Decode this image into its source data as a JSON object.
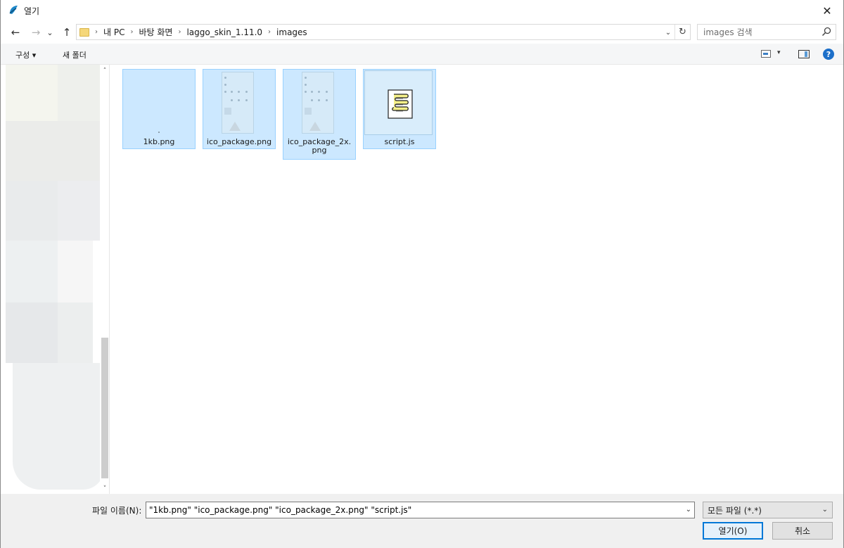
{
  "window": {
    "title": "열기",
    "close_glyph": "✕"
  },
  "nav": {
    "back_glyph": "←",
    "forward_glyph": "→",
    "recent_glyph": "⌄",
    "up_glyph": "↑",
    "breadcrumbs": [
      "내 PC",
      "바탕 화면",
      "laggo_skin_1.11.0",
      "images"
    ],
    "separator": "›",
    "address_dropdown_glyph": "⌄",
    "refresh_glyph": "↻",
    "search_placeholder": "images 검색"
  },
  "commands": {
    "organize": "구성 ▾",
    "new_folder": "새 폴더",
    "view_dropdown_glyph": "▾",
    "help_glyph": "?"
  },
  "navpane": {
    "scroll_up_glyph": "˄",
    "scroll_down_glyph": "˅"
  },
  "files": [
    {
      "name": "1kb.png",
      "type": "png-tiny",
      "selected": true
    },
    {
      "name": "ico_package.png",
      "type": "png-sprite",
      "selected": true
    },
    {
      "name": "ico_package_2x.png",
      "name_line1": "ico_package_2x.",
      "name_line2": "png",
      "type": "png-sprite",
      "selected": true
    },
    {
      "name": "script.js",
      "type": "script",
      "selected": true
    }
  ],
  "bottom": {
    "filename_label": "파일 이름(N):",
    "filename_value": "\"1kb.png\" \"ico_package.png\" \"ico_package_2x.png\" \"script.js\"",
    "filetype_value": "모든 파일 (*.*)",
    "dropdown_glyph": "⌄",
    "open_label": "열기(O)",
    "cancel_label": "취소"
  },
  "colors": {
    "selection_bg": "#cce8ff",
    "selection_border": "#99d1ff",
    "accent": "#0078d7"
  }
}
